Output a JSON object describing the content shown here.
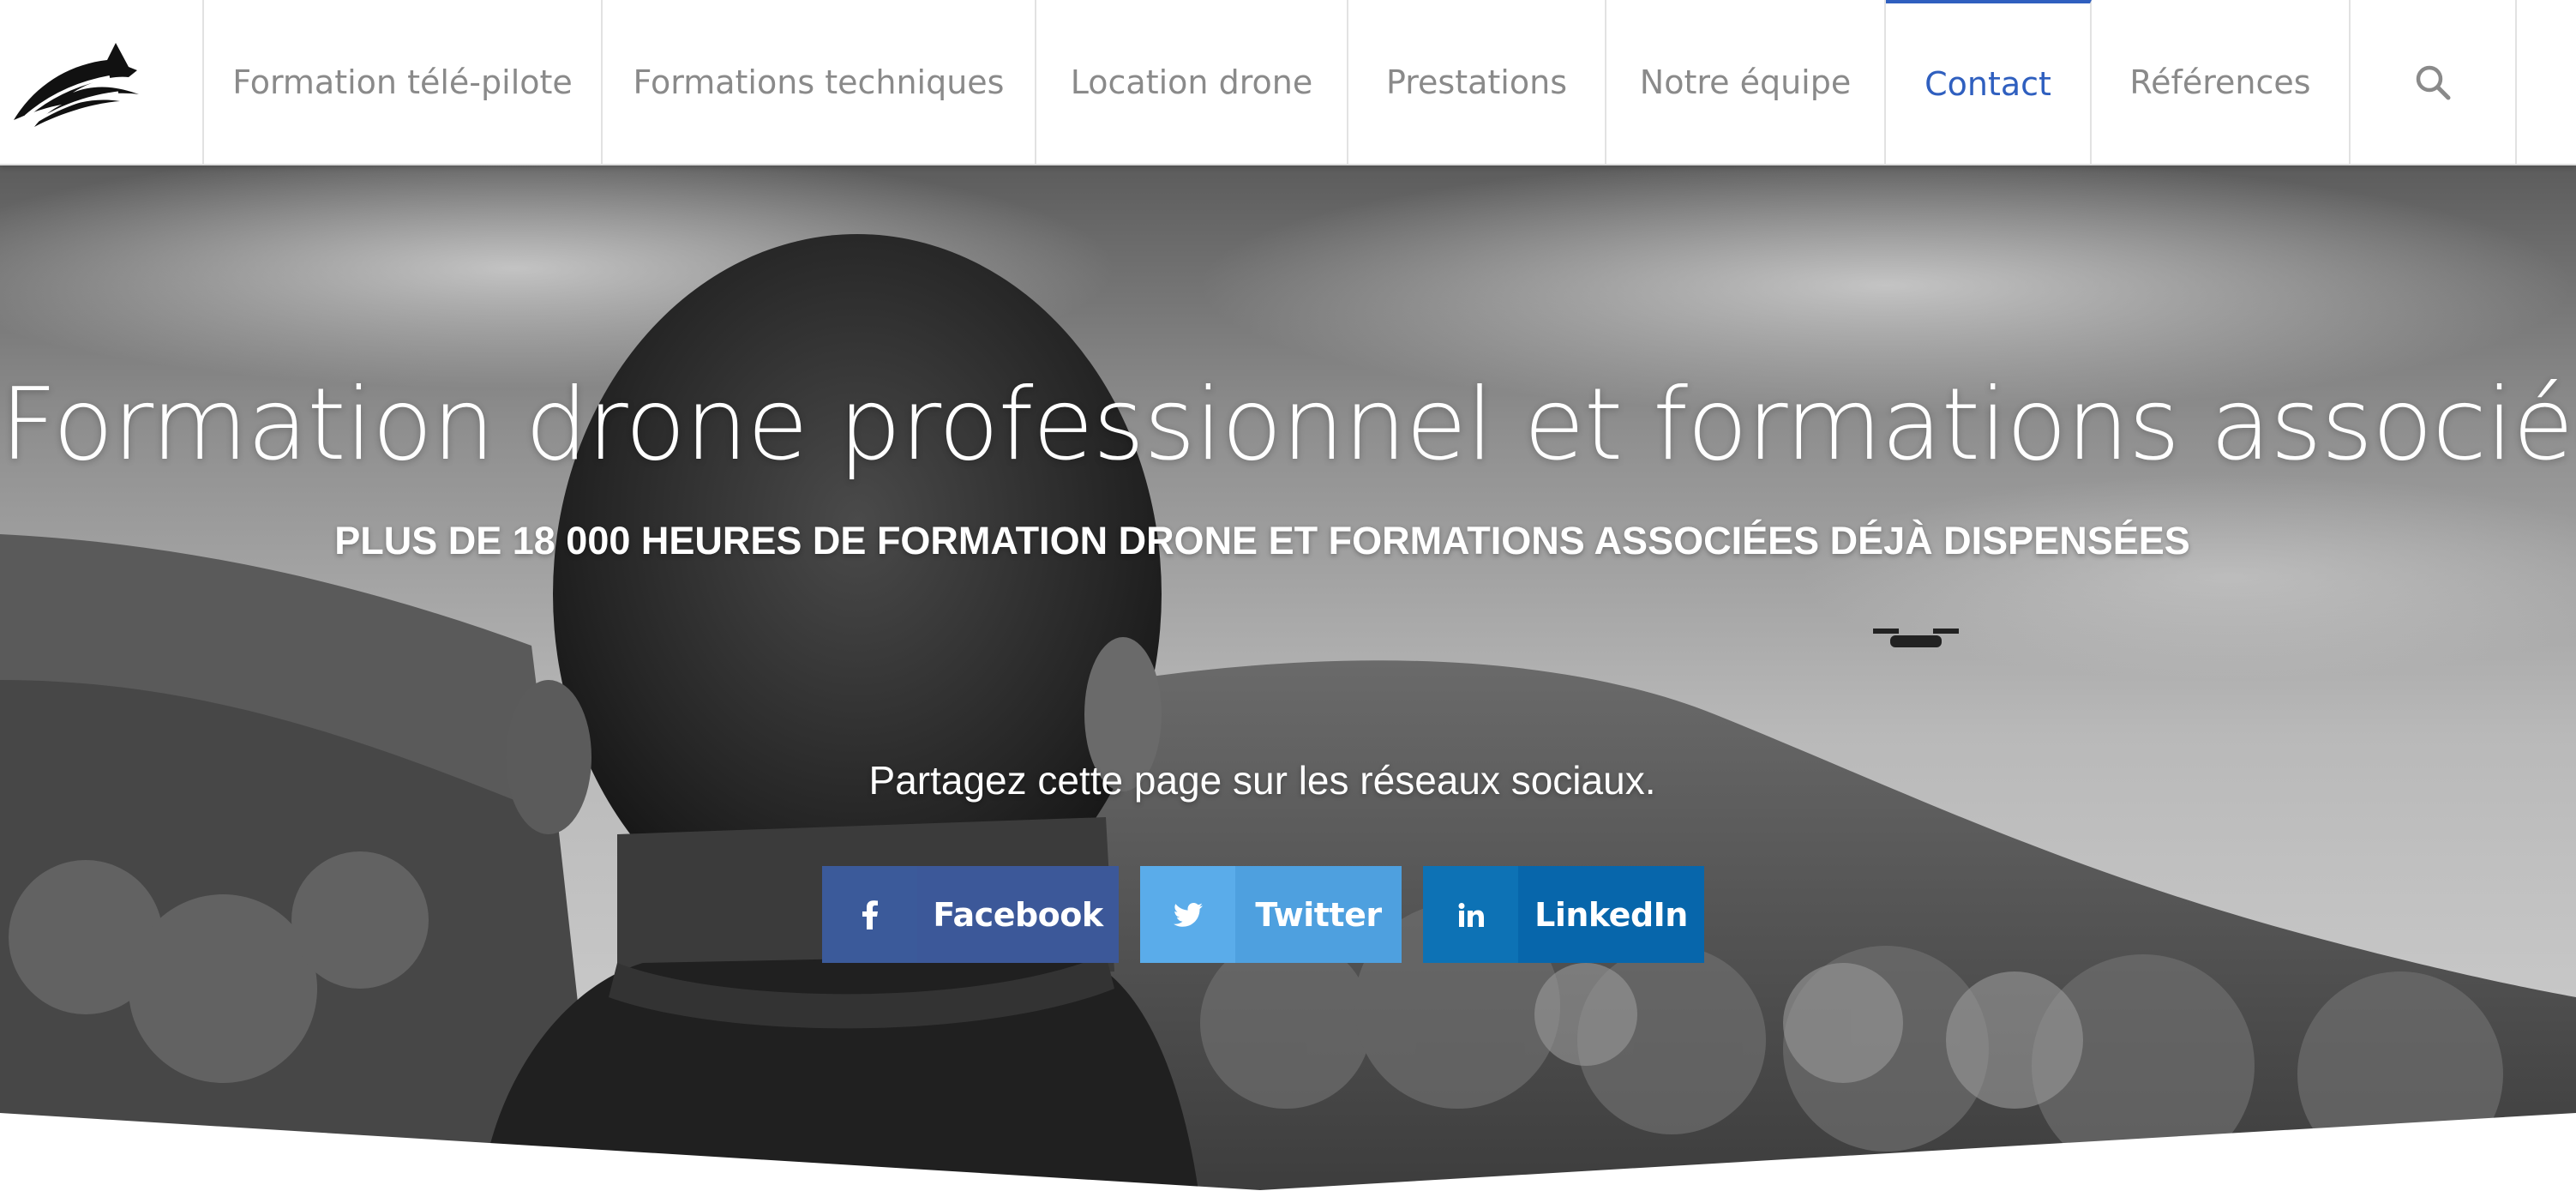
{
  "nav": {
    "logo_icon": "drone-wing-logo-icon",
    "items": [
      {
        "label": "Formation télé-pilote",
        "active": false
      },
      {
        "label": "Formations techniques",
        "active": false
      },
      {
        "label": "Location drone",
        "active": false
      },
      {
        "label": "Prestations",
        "active": false
      },
      {
        "label": "Notre équipe",
        "active": false
      },
      {
        "label": "Contact",
        "active": true
      },
      {
        "label": "Références",
        "active": false
      }
    ],
    "search_icon": "search-icon",
    "active_color": "#2f5fbf",
    "text_color": "#8a8a8a"
  },
  "hero": {
    "title": "Formation drone professionnel et formations associées.",
    "subtitle": "PLUS DE 18 000 HEURES DE FORMATION DRONE ET FORMATIONS ASSOCIÉES DÉJÀ DISPENSÉES",
    "share_text": "Partagez cette page sur les réseaux sociaux.",
    "share_buttons": [
      {
        "label": "Facebook",
        "icon": "facebook-icon",
        "color": "#3c5899"
      },
      {
        "label": "Twitter",
        "icon": "twitter-icon",
        "color": "#4ea0df"
      },
      {
        "label": "LinkedIn",
        "icon": "linkedin-icon",
        "color": "#0766ab"
      }
    ]
  }
}
